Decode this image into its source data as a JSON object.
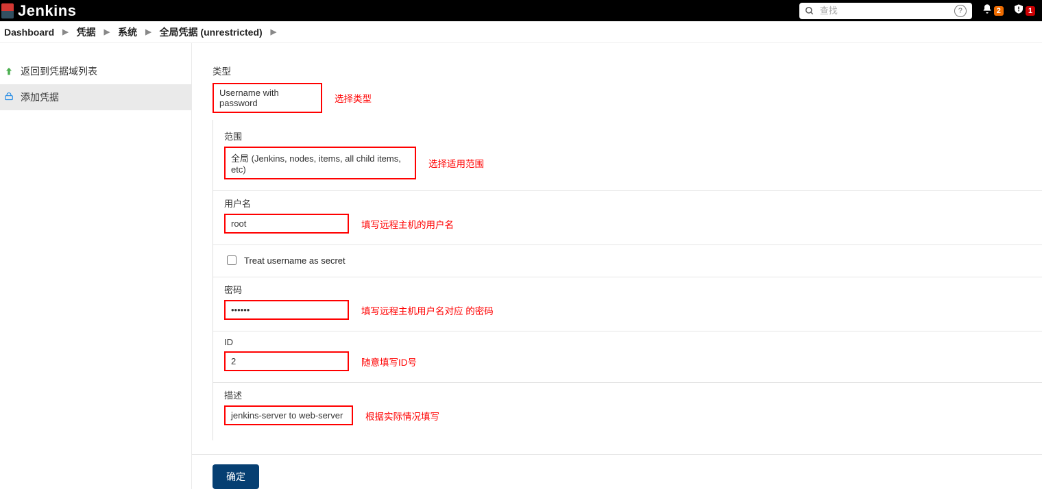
{
  "header": {
    "logo_text": "Jenkins",
    "search_placeholder": "查找",
    "notif_count": "2",
    "alert_count": "1"
  },
  "breadcrumb": {
    "items": [
      "Dashboard",
      "凭据",
      "系统",
      "全局凭据 (unrestricted)"
    ]
  },
  "sidebar": {
    "items": [
      {
        "label": "返回到凭据域列表"
      },
      {
        "label": "添加凭据"
      }
    ]
  },
  "form": {
    "type_label": "类型",
    "type_value": "Username with password",
    "type_note": "选择类型",
    "scope_label": "范围",
    "scope_value": "全局 (Jenkins, nodes, items, all child items, etc)",
    "scope_note": "选择适用范围",
    "username_label": "用户名",
    "username_value": "root",
    "username_note": "填写远程主机的用户名",
    "treat_secret_label": "Treat username as secret",
    "password_label": "密码",
    "password_value": "••••••",
    "password_note": "填写远程主机用户名对应 的密码",
    "id_label": "ID",
    "id_value": "2",
    "id_note": "随意填写ID号",
    "desc_label": "描述",
    "desc_value": "jenkins-server to web-server",
    "desc_note": "根据实际情况填写",
    "ok_label": "确定"
  }
}
